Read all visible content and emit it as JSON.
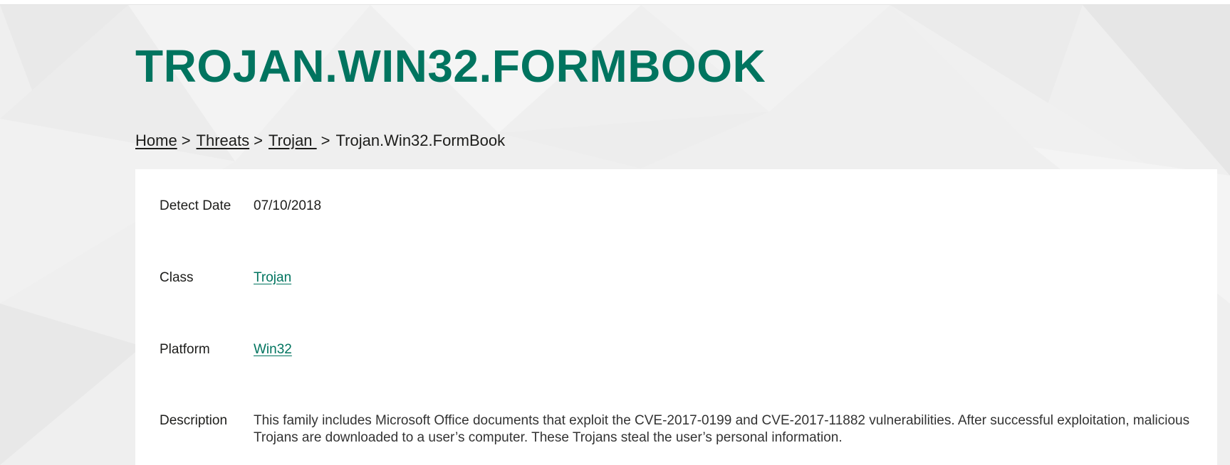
{
  "colors": {
    "brand_green": "#00745f",
    "text_dark": "#1d1d1b",
    "background_gray": "#efefef",
    "card_white": "#ffffff"
  },
  "page": {
    "title": "TROJAN.WIN32.FORMBOOK"
  },
  "breadcrumb": {
    "items": [
      {
        "label": "Home"
      },
      {
        "label": "Threats"
      },
      {
        "label": "Trojan "
      }
    ],
    "separator": ">",
    "current": "Trojan.Win32.FormBook"
  },
  "details": {
    "detect_date": {
      "label": "Detect Date",
      "value": "07/10/2018"
    },
    "class": {
      "label": "Class",
      "value": "Trojan"
    },
    "platform": {
      "label": "Platform",
      "value": "Win32"
    },
    "description": {
      "label": "Description",
      "value": "This family includes Microsoft Office documents that exploit the CVE-2017-0199 and CVE-2017-11882 vulnerabilities. After successful exploitation, malicious Trojans are downloaded to a user’s computer. These Trojans steal the user’s personal information."
    }
  }
}
